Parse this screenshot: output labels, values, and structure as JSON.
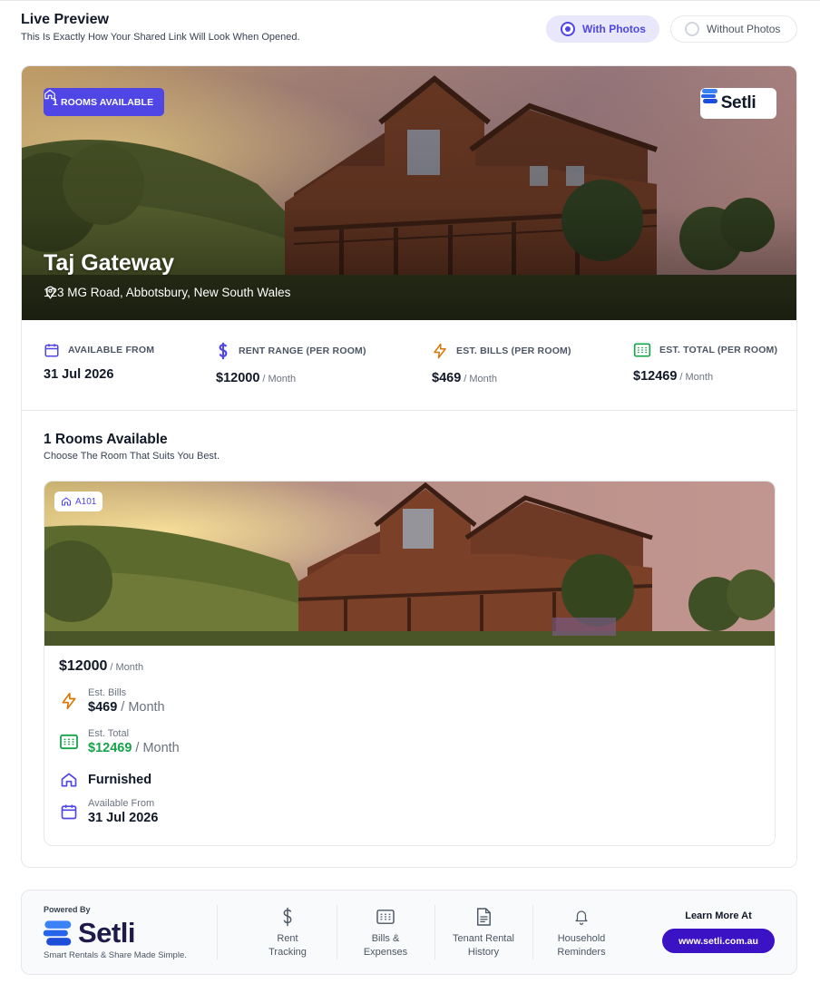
{
  "header": {
    "title": "Live Preview",
    "subtitle": "This Is Exactly How Your Shared Link Will Look When Opened."
  },
  "view_toggle": {
    "with_photos": "With Photos",
    "without_photos": "Without Photos",
    "selected": "With Photos"
  },
  "property": {
    "rooms_badge": "1 ROOMS AVAILABLE",
    "brand": "Setli",
    "name": "Taj Gateway",
    "address": "123 MG Road, Abbotsbury, New South Wales"
  },
  "stats": {
    "available": {
      "label": "AVAILABLE FROM",
      "value": "31 Jul 2026"
    },
    "rent": {
      "label": "RENT RANGE (PER ROOM)",
      "value": "$12000",
      "per": "/ Month"
    },
    "bills": {
      "label": "EST. BILLS (PER ROOM)",
      "value": "$469",
      "per": "/ Month"
    },
    "total": {
      "label": "EST. TOTAL (PER ROOM)",
      "value": "$12469",
      "per": "/ Month"
    }
  },
  "rooms_section": {
    "title": "1 Rooms Available",
    "subtitle": "Choose The Room That Suits You Best."
  },
  "rooms": [
    {
      "tag": "A101",
      "price": "$12000",
      "price_per": "/ Month",
      "bills_label": "Est. Bills",
      "bills_value": "$469",
      "bills_per": "/ Month",
      "total_label": "Est. Total",
      "total_value": "$12469",
      "total_per": "/ Month",
      "furnished": "Furnished",
      "available_label": "Available From",
      "available_value": "31 Jul 2026"
    }
  ],
  "footer": {
    "powered_by": "Powered By",
    "brand": "Setli",
    "tagline": "Smart Rentals & Share Made Simple.",
    "features": [
      {
        "line1": "Rent",
        "line2": "Tracking",
        "icon": "dollar-icon"
      },
      {
        "line1": "Bills &",
        "line2": "Expenses",
        "icon": "calculator-icon"
      },
      {
        "line1": "Tenant Rental",
        "line2": "History",
        "icon": "document-icon"
      },
      {
        "line1": "Household",
        "line2": "Reminders",
        "icon": "bell-icon"
      }
    ],
    "learn_more": "Learn More At",
    "link": "www.setli.com.au"
  },
  "colors": {
    "accent": "#4f46e5",
    "green": "#16a34a",
    "orange": "#d97706",
    "button": "#3b12c4"
  }
}
